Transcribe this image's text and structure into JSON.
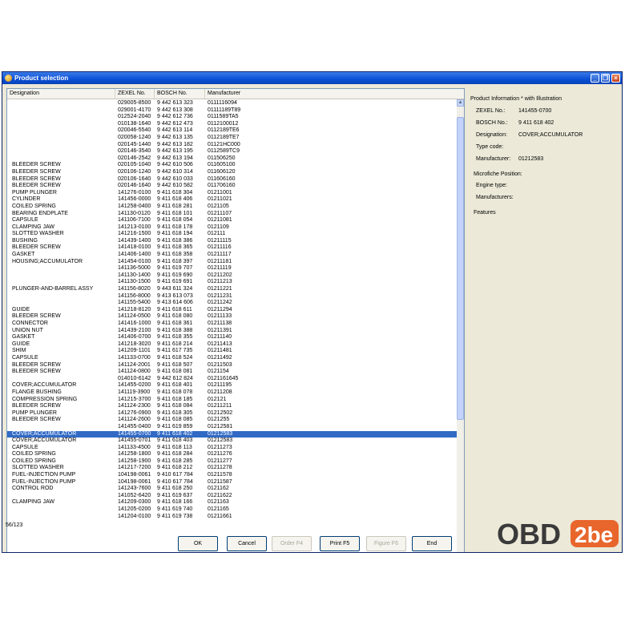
{
  "window": {
    "title": "Product selection"
  },
  "columns": {
    "designation": "Designation",
    "zexel": "ZEXEL No.",
    "bosch": "BOSCH No.",
    "manufacturer": "Manufacturer"
  },
  "rows": [
    {
      "d": "",
      "z": "029005-8500",
      "b": "9 442 613 323",
      "m": "0111116094"
    },
    {
      "d": "",
      "z": "029001-4170",
      "b": "9 442 613 308",
      "m": "01111189T89"
    },
    {
      "d": "",
      "z": "012524-2040",
      "b": "9 442 612 736",
      "m": "0111589TA5"
    },
    {
      "d": "",
      "z": "010138-1640",
      "b": "9 442 612 473",
      "m": "0112100012"
    },
    {
      "d": "",
      "z": "020046-5540",
      "b": "9 442 613 114",
      "m": "0112189TE6"
    },
    {
      "d": "",
      "z": "020058-1240",
      "b": "9 442 613 135",
      "m": "0112189TE7"
    },
    {
      "d": "",
      "z": "020145-1440",
      "b": "9 442 613 182",
      "m": "01121HC000"
    },
    {
      "d": "",
      "z": "020146-3540",
      "b": "9 442 613 195",
      "m": "0112589TC9"
    },
    {
      "d": "",
      "z": "020146-2542",
      "b": "9 442 613 194",
      "m": "011506250"
    },
    {
      "d": "BLEEDER SCREW",
      "z": "020105-1040",
      "b": "9 442 610 506",
      "m": "011605100"
    },
    {
      "d": "BLEEDER SCREW",
      "z": "020106-1240",
      "b": "9 442 610 314",
      "m": "011606120"
    },
    {
      "d": "BLEEDER SCREW",
      "z": "020106-1640",
      "b": "9 442 610 033",
      "m": "011606160"
    },
    {
      "d": "BLEEDER SCREW",
      "z": "020146-1640",
      "b": "9 442 610 582",
      "m": "011706160"
    },
    {
      "d": "PUMP PLUNGER",
      "z": "141276-0100",
      "b": "9 411 618 304",
      "m": "01211001"
    },
    {
      "d": "CYLINDER",
      "z": "141456-0000",
      "b": "9 411 618 406",
      "m": "01211021"
    },
    {
      "d": "COILED SPRING",
      "z": "141258-0400",
      "b": "9 411 618 281",
      "m": "0121105"
    },
    {
      "d": "BEARING ENDPLATE",
      "z": "141130-0120",
      "b": "9 411 618 101",
      "m": "01211107"
    },
    {
      "d": "CAPSULE",
      "z": "141106-7100",
      "b": "9 411 618 054",
      "m": "01211081"
    },
    {
      "d": "CLAMPING JAW",
      "z": "141213-0100",
      "b": "9 411 618 178",
      "m": "0121109"
    },
    {
      "d": "SLOTTED WASHER",
      "z": "141216-1500",
      "b": "9 411 618 194",
      "m": "012111"
    },
    {
      "d": "BUSHING",
      "z": "141439-1400",
      "b": "9 411 618 386",
      "m": "01211115"
    },
    {
      "d": "BLEEDER SCREW",
      "z": "141418-0100",
      "b": "9 411 618 365",
      "m": "01211116"
    },
    {
      "d": "GASKET",
      "z": "141406-1400",
      "b": "9 411 618 358",
      "m": "01211117"
    },
    {
      "d": "HOUSING;ACCUMULATOR",
      "z": "141454-0100",
      "b": "9 411 618 397",
      "m": "01211181"
    },
    {
      "d": "",
      "z": "141136-5000",
      "b": "9 411 619 707",
      "m": "01211119"
    },
    {
      "d": "",
      "z": "141130-1400",
      "b": "9 411 619 690",
      "m": "01211202"
    },
    {
      "d": "",
      "z": "141130-1500",
      "b": "9 411 619 691",
      "m": "01211213"
    },
    {
      "d": "PLUNGER-AND-BARREL ASSY",
      "z": "141156-8020",
      "b": "9 443 611 324",
      "m": "01211221"
    },
    {
      "d": "",
      "z": "141156-8000",
      "b": "9 413 613 073",
      "m": "01211231"
    },
    {
      "d": "",
      "z": "141155-5400",
      "b": "9 413 614 606",
      "m": "01211242"
    },
    {
      "d": "GUIDE",
      "z": "141218-8120",
      "b": "9 411 618 611",
      "m": "01211294"
    },
    {
      "d": "BLEEDER SCREW",
      "z": "141124-0500",
      "b": "9 411 618 080",
      "m": "01211133"
    },
    {
      "d": "CONNECTOR",
      "z": "141416-1000",
      "b": "9 411 618 361",
      "m": "01211138"
    },
    {
      "d": "UNION NUT",
      "z": "141439-2100",
      "b": "9 411 618 388",
      "m": "01211391"
    },
    {
      "d": "GASKET",
      "z": "141406-0700",
      "b": "9 411 618 355",
      "m": "01211140"
    },
    {
      "d": "GUIDE",
      "z": "141218-3020",
      "b": "9 411 618 214",
      "m": "01211413"
    },
    {
      "d": "SHIM",
      "z": "141209-1101",
      "b": "9 411 617 735",
      "m": "01211481"
    },
    {
      "d": "CAPSULE",
      "z": "141133-0700",
      "b": "9 411 618 524",
      "m": "01211492"
    },
    {
      "d": "BLEEDER SCREW",
      "z": "141124-2001",
      "b": "9 411 618 507",
      "m": "01211503"
    },
    {
      "d": "BLEEDER SCREW",
      "z": "141124-0800",
      "b": "9 411 618 081",
      "m": "0121154"
    },
    {
      "d": "",
      "z": "014010-6142",
      "b": "9 442 612 824",
      "m": "0121161645"
    },
    {
      "d": "COVER;ACCUMULATOR",
      "z": "141455-0200",
      "b": "9 411 618 401",
      "m": "01211195"
    },
    {
      "d": "FLANGE BUSHING",
      "z": "141119-3900",
      "b": "9 411 618 078",
      "m": "01211208"
    },
    {
      "d": "COMPRESSION SPRING",
      "z": "141215-3700",
      "b": "9 411 618 185",
      "m": "012121"
    },
    {
      "d": "BLEEDER SCREW",
      "z": "141124-2300",
      "b": "9 411 618 084",
      "m": "01211211"
    },
    {
      "d": "PUMP PLUNGER",
      "z": "141276-0900",
      "b": "9 411 618 305",
      "m": "01212502"
    },
    {
      "d": "BLEEDER SCREW",
      "z": "141124-2600",
      "b": "9 411 618 085",
      "m": "0121255"
    },
    {
      "d": "",
      "z": "141455-0400",
      "b": "9 411 619 859",
      "m": "01212581"
    },
    {
      "d": "COVER;ACCUMULATOR",
      "z": "141455-0700",
      "b": "9 411 618 402",
      "m": "01212583",
      "sel": true
    },
    {
      "d": "COVER;ACCUMULATOR",
      "z": "141455-0701",
      "b": "9 411 618 403",
      "m": "01212583"
    },
    {
      "d": "CAPSULE",
      "z": "141133-4500",
      "b": "9 411 618 113",
      "m": "01211273"
    },
    {
      "d": "COILED SPRING",
      "z": "141258-1800",
      "b": "9 411 618 284",
      "m": "01211276"
    },
    {
      "d": "COILED SPRING",
      "z": "141258-1900",
      "b": "9 411 618 285",
      "m": "01211277"
    },
    {
      "d": "SLOTTED WASHER",
      "z": "141217-7200",
      "b": "9 411 618 212",
      "m": "01211278"
    },
    {
      "d": "FUEL-INJECTION PUMP",
      "z": "104198-0061",
      "b": "9 410 617 784",
      "m": "01211578"
    },
    {
      "d": "FUEL-INJECTION PUMP",
      "z": "104198-0061",
      "b": "9 410 617 784",
      "m": "01211587"
    },
    {
      "d": "CONTROL ROD",
      "z": "141243-7600",
      "b": "9 411 618 250",
      "m": "0121162"
    },
    {
      "d": "",
      "z": "141052-6420",
      "b": "9 411 619 637",
      "m": "01211622"
    },
    {
      "d": "CLAMPING JAW",
      "z": "141209-0300",
      "b": "9 411 618 166",
      "m": "0121163"
    },
    {
      "d": "",
      "z": "141205-0200",
      "b": "9 411 619 740",
      "m": "0121165"
    },
    {
      "d": "",
      "z": "141204-0100",
      "b": "9 411 619 738",
      "m": "01211661"
    }
  ],
  "info": {
    "heading": "Product Information * with Illustration",
    "zexel_label": "ZEXEL No.:",
    "zexel_value": "141455-0700",
    "bosch_label": "BOSCH No.:",
    "bosch_value": "9 411 618 402",
    "designation_label": "Designation:",
    "designation_value": "COVER;ACCUMULATOR",
    "type_label": "Type code:",
    "manufacturer_label": "Manufacturer:",
    "manufacturer_value": "01212583",
    "microfiche_label": "Microfiche Position:",
    "engine_label": "Engine type:",
    "manufacturers_label": "Manufacturers:",
    "features_label": "Features"
  },
  "status": {
    "count": "56/123"
  },
  "buttons": {
    "ok": "OK",
    "cancel": "Cancel",
    "order": "Order F4",
    "print": "Print F5",
    "figure": "Figure F6",
    "end": "End"
  },
  "logo": {
    "text1": "OBD",
    "text2": "2be",
    "color": "#e8652b"
  }
}
